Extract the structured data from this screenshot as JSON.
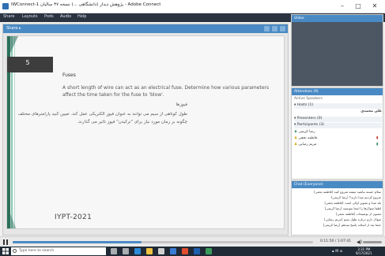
{
  "window": {
    "title": "IWConnect-1 پژوهش دیدار (دانشگاهی ...) نسخه ۳۷ سالیان - Adobe Connect",
    "controls": [
      "–",
      "□",
      "✕"
    ]
  },
  "toolbar": {
    "items": [
      "Share",
      "Layouts",
      "Pods",
      "Audio",
      "Help"
    ]
  },
  "share_pod": {
    "label": "Share ▸"
  },
  "slide": {
    "number": "5",
    "title": "Fuses",
    "body_en": "A short length of wire can act as an electrical fuse. Determine how various parameters affect the time taken for the fuse to 'blow'.",
    "title_fa": "فیوزها",
    "body_fa": "طول کوتاهی از سیم می توانند به عنوان فیوز الکتریکی عمل کند. تعیین کنید پارامترهای مختلف چگونه بر زمان مورد نیاز برای \"ترکیدن\" فیوز تاثیر می گذارند.",
    "footer": "IYPT-2021"
  },
  "video_pod": {
    "label": "Video"
  },
  "attendees": {
    "label": "Attendees (9)",
    "status_label": "Active Speakers",
    "hosts_label": "Hosts (1)",
    "host_name": "علی محمدی",
    "presenters_label": "Presenters (0)",
    "participants_label": "Participants (3)",
    "participants": [
      "رضا کریمی",
      "فاطمه نجفی",
      "مریم رضایی"
    ]
  },
  "chat": {
    "label": "Chat (Everyone)",
    "messages": [
      "سلام خسته نباشید میشه شروع کنید (فاطمه نجفی)",
      "شروع کردیم صدا دارید؟ (رضا کریمی)",
      "بله صدا و تصویر اوکی است (فاطمه نجفی)",
      "لطفا سوال‌ها را اینجا بنویسید (رضا کریمی)",
      "ممنون از توضیحات (فاطمه نجفی)",
      "سوال دارم درباره طول سیم (مریم رضایی)",
      "حتما بعد از اسلاید پاسخ میدهم (رضا کریمی)"
    ]
  },
  "playback": {
    "progress": 0.43,
    "timecode": "0:11:50 / 1:07:41"
  },
  "taskbar": {
    "search_placeholder": "Type here to search",
    "clock_time": "3:31 PM",
    "clock_date": "9/17/2021"
  },
  "colors": {
    "accent": "#4a8ac4",
    "slide_stripe_dark": "#2c6f5b",
    "slide_stripe_light": "#8bc9b4"
  }
}
